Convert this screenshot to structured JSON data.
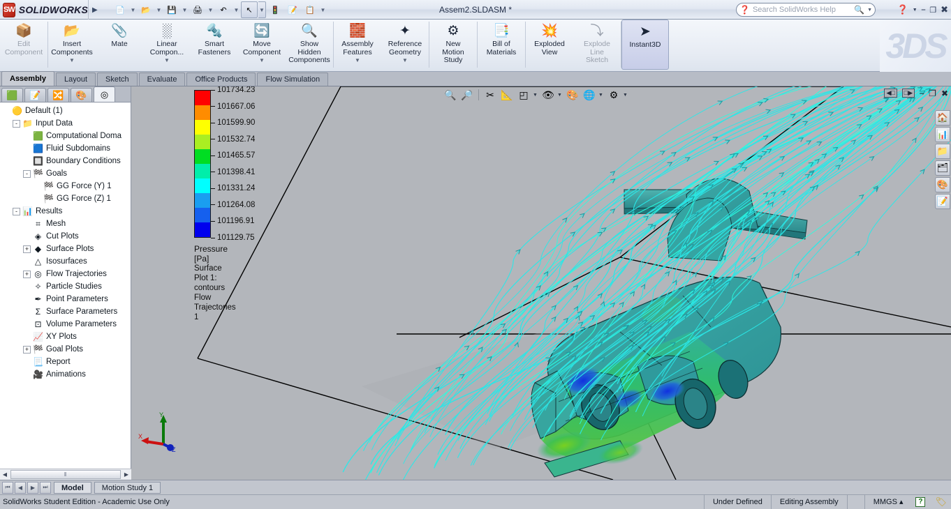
{
  "titlebar": {
    "brand": "SOLIDWORKS",
    "brand_mark": "SW",
    "document_title": "Assem2.SLDASM *",
    "search_placeholder": "Search SolidWorks Help",
    "icons": [
      {
        "name": "new-document-icon",
        "glyph": "📄",
        "caret": true
      },
      {
        "name": "open-document-icon",
        "glyph": "📂",
        "caret": true
      },
      {
        "name": "save-icon",
        "glyph": "💾",
        "caret": true
      },
      {
        "name": "print-icon",
        "glyph": "🖨",
        "caret": true
      },
      {
        "name": "undo-icon",
        "glyph": "↶",
        "caret": true
      },
      {
        "name": "select-pointer-icon",
        "glyph": "↖",
        "caret": true,
        "pressed": true
      },
      {
        "name": "rebuild-icon",
        "glyph": "🚦",
        "caret": false
      },
      {
        "name": "options-icon",
        "glyph": "📝",
        "caret": false
      },
      {
        "name": "checklist-icon",
        "glyph": "📋",
        "caret": true
      }
    ],
    "window_controls": [
      "help-icon",
      "caret-icon",
      "minimize-icon",
      "restore-icon",
      "close-icon"
    ]
  },
  "ribbon": {
    "brand_watermark": "3DS",
    "commands": [
      {
        "label": "Edit\nComponent",
        "icon": "edit-component-icon",
        "glyph": "📦",
        "disabled": true,
        "dropdown": false
      },
      {
        "label": "Insert\nComponents",
        "icon": "insert-components-icon",
        "glyph": "📂",
        "disabled": false,
        "dropdown": true
      },
      {
        "label": "Mate",
        "icon": "mate-icon",
        "glyph": "📎",
        "disabled": false,
        "dropdown": false
      },
      {
        "label": "Linear\nCompon...",
        "icon": "linear-component-pattern-icon",
        "glyph": "░",
        "disabled": false,
        "dropdown": true
      },
      {
        "label": "Smart\nFasteners",
        "icon": "smart-fasteners-icon",
        "glyph": "🔩",
        "disabled": false,
        "dropdown": false
      },
      {
        "label": "Move\nComponent",
        "icon": "move-component-icon",
        "glyph": "🔄",
        "disabled": false,
        "dropdown": true
      },
      {
        "label": "Show\nHidden\nComponents",
        "icon": "show-hidden-components-icon",
        "glyph": "🔍",
        "disabled": false,
        "dropdown": false
      },
      {
        "label": "Assembly\nFeatures",
        "icon": "assembly-features-icon",
        "glyph": "🧱",
        "disabled": false,
        "dropdown": true
      },
      {
        "label": "Reference\nGeometry",
        "icon": "reference-geometry-icon",
        "glyph": "✦",
        "disabled": false,
        "dropdown": true
      },
      {
        "label": "New\nMotion\nStudy",
        "icon": "new-motion-study-icon",
        "glyph": "⚙",
        "disabled": false,
        "dropdown": false
      },
      {
        "label": "Bill of\nMaterials",
        "icon": "bill-of-materials-icon",
        "glyph": "📑",
        "disabled": false,
        "dropdown": false
      },
      {
        "label": "Exploded\nView",
        "icon": "exploded-view-icon",
        "glyph": "💥",
        "disabled": false,
        "dropdown": false
      },
      {
        "label": "Explode\nLine\nSketch",
        "icon": "explode-line-sketch-icon",
        "glyph": "⤵",
        "disabled": true,
        "dropdown": false
      },
      {
        "label": "Instant3D",
        "icon": "instant3d-icon",
        "glyph": "➤",
        "disabled": false,
        "dropdown": false,
        "selected": true
      }
    ]
  },
  "command_tabs": {
    "items": [
      {
        "label": "Assembly",
        "active": true
      },
      {
        "label": "Layout",
        "active": false
      },
      {
        "label": "Sketch",
        "active": false
      },
      {
        "label": "Evaluate",
        "active": false
      },
      {
        "label": "Office Products",
        "active": false
      },
      {
        "label": "Flow Simulation",
        "active": false
      }
    ]
  },
  "left_panel": {
    "tree_tabs": [
      {
        "name": "feature-manager-tab",
        "glyph": "🟩",
        "active": false
      },
      {
        "name": "property-manager-tab",
        "glyph": "📝",
        "active": false
      },
      {
        "name": "configuration-manager-tab",
        "glyph": "🔀",
        "active": false
      },
      {
        "name": "display-manager-tab",
        "glyph": "🎨",
        "active": false
      },
      {
        "name": "flow-simulation-tab",
        "glyph": "◎",
        "active": true
      }
    ],
    "tree": [
      {
        "label": "Default (1)",
        "indent": 0,
        "expander": "",
        "icon": "project-icon",
        "glyph": "🟡"
      },
      {
        "label": "Input Data",
        "indent": 1,
        "expander": "-",
        "icon": "input-data-folder-icon",
        "glyph": "📁"
      },
      {
        "label": "Computational Doma",
        "indent": 2,
        "expander": "",
        "icon": "computational-domain-icon",
        "glyph": "🟩"
      },
      {
        "label": "Fluid Subdomains",
        "indent": 2,
        "expander": "",
        "icon": "fluid-subdomains-icon",
        "glyph": "🟦"
      },
      {
        "label": "Boundary Conditions",
        "indent": 2,
        "expander": "",
        "icon": "boundary-conditions-icon",
        "glyph": "🔲"
      },
      {
        "label": "Goals",
        "indent": 2,
        "expander": "-",
        "icon": "goals-icon",
        "glyph": "🏁"
      },
      {
        "label": "GG Force (Y) 1",
        "indent": 3,
        "expander": "",
        "icon": "goal-icon",
        "glyph": "🏁"
      },
      {
        "label": "GG Force (Z) 1",
        "indent": 3,
        "expander": "",
        "icon": "goal-icon",
        "glyph": "🏁"
      },
      {
        "label": "Results",
        "indent": 1,
        "expander": "-",
        "icon": "results-icon",
        "glyph": "📊"
      },
      {
        "label": "Mesh",
        "indent": 2,
        "expander": "",
        "icon": "mesh-icon",
        "glyph": "⌗"
      },
      {
        "label": "Cut Plots",
        "indent": 2,
        "expander": "",
        "icon": "cut-plots-icon",
        "glyph": "◈"
      },
      {
        "label": "Surface Plots",
        "indent": 2,
        "expander": "+",
        "icon": "surface-plots-icon",
        "glyph": "◆"
      },
      {
        "label": "Isosurfaces",
        "indent": 2,
        "expander": "",
        "icon": "isosurfaces-icon",
        "glyph": "△"
      },
      {
        "label": "Flow Trajectories",
        "indent": 2,
        "expander": "+",
        "icon": "flow-trajectories-icon",
        "glyph": "◎"
      },
      {
        "label": "Particle Studies",
        "indent": 2,
        "expander": "",
        "icon": "particle-studies-icon",
        "glyph": "✧"
      },
      {
        "label": "Point Parameters",
        "indent": 2,
        "expander": "",
        "icon": "point-parameters-icon",
        "glyph": "✒"
      },
      {
        "label": "Surface Parameters",
        "indent": 2,
        "expander": "",
        "icon": "surface-parameters-icon",
        "glyph": "Σ"
      },
      {
        "label": "Volume Parameters",
        "indent": 2,
        "expander": "",
        "icon": "volume-parameters-icon",
        "glyph": "⊡"
      },
      {
        "label": "XY Plots",
        "indent": 2,
        "expander": "",
        "icon": "xy-plots-icon",
        "glyph": "📈"
      },
      {
        "label": "Goal Plots",
        "indent": 2,
        "expander": "+",
        "icon": "goal-plots-icon",
        "glyph": "🏁"
      },
      {
        "label": "Report",
        "indent": 2,
        "expander": "",
        "icon": "report-icon",
        "glyph": "📃"
      },
      {
        "label": "Animations",
        "indent": 2,
        "expander": "",
        "icon": "animations-icon",
        "glyph": "🎥"
      }
    ],
    "scroll_thumb": "‖"
  },
  "view_toolbar": {
    "buttons": [
      {
        "name": "zoom-to-fit-icon",
        "glyph": "🔍",
        "caret": false
      },
      {
        "name": "zoom-to-area-icon",
        "glyph": "🔎",
        "caret": false
      },
      {
        "name": "section-view-icon",
        "glyph": "✂",
        "caret": false
      },
      {
        "name": "view-orientation-icon",
        "glyph": "📐",
        "caret": false
      },
      {
        "name": "display-style-icon",
        "glyph": "◰",
        "caret": true
      },
      {
        "name": "hide-show-items-icon",
        "glyph": "👁",
        "caret": true
      },
      {
        "name": "edit-appearance-icon",
        "glyph": "🎨",
        "caret": false
      },
      {
        "name": "apply-scene-icon",
        "glyph": "🌐",
        "caret": true
      },
      {
        "name": "view-settings-icon",
        "glyph": "⚙",
        "caret": true
      }
    ],
    "window_buttons": [
      "restore-left-icon",
      "restore-right-icon",
      "minimize-icon",
      "restore-icon",
      "close-icon"
    ]
  },
  "task_pane": [
    {
      "name": "solidworks-resources-icon",
      "glyph": "🏠"
    },
    {
      "name": "design-library-icon",
      "glyph": "📊"
    },
    {
      "name": "file-explorer-icon",
      "glyph": "📁"
    },
    {
      "name": "view-palette-icon",
      "glyph": "🗂"
    },
    {
      "name": "appearances-scenes-icon",
      "glyph": "🎨"
    },
    {
      "name": "custom-properties-icon",
      "glyph": "📝"
    }
  ],
  "chart_data": {
    "type": "heatmap",
    "title": "Pressure [Pa]",
    "unit_label": "Pressure [Pa]",
    "annotations": [
      "Surface Plot 1: contours",
      "Flow Trajectories 1"
    ],
    "legend_position": "left",
    "colorbar": {
      "orientation": "vertical",
      "min": 101129.75,
      "max": 101734.23,
      "tick_labels": [
        "101734.23",
        "101667.06",
        "101599.90",
        "101532.74",
        "101465.57",
        "101398.41",
        "101331.24",
        "101264.08",
        "101196.91",
        "101129.75"
      ],
      "tick_values": [
        101734.23,
        101667.06,
        101599.9,
        101532.74,
        101465.57,
        101398.41,
        101331.24,
        101264.08,
        101196.91,
        101129.75
      ],
      "colors_top_to_bottom": [
        "#ff0000",
        "#ff8c00",
        "#ffff00",
        "#aaee22",
        "#00dd22",
        "#00eeaa",
        "#00ffff",
        "#1a9ef0",
        "#1560ee",
        "#0000ee"
      ]
    }
  },
  "bottom_tabs": {
    "nav_buttons": [
      "first-icon",
      "previous-icon",
      "next-icon",
      "last-icon"
    ],
    "tabs": [
      {
        "label": "Model",
        "active": true
      },
      {
        "label": "Motion Study 1",
        "active": false
      }
    ]
  },
  "status_bar": {
    "left_text": "SolidWorks Student Edition - Academic Use Only",
    "segments": [
      "Under Defined",
      "Editing Assembly",
      "",
      "MMGS  ▴"
    ],
    "help_glyph": "?",
    "tag_icon": "tag-icon"
  }
}
